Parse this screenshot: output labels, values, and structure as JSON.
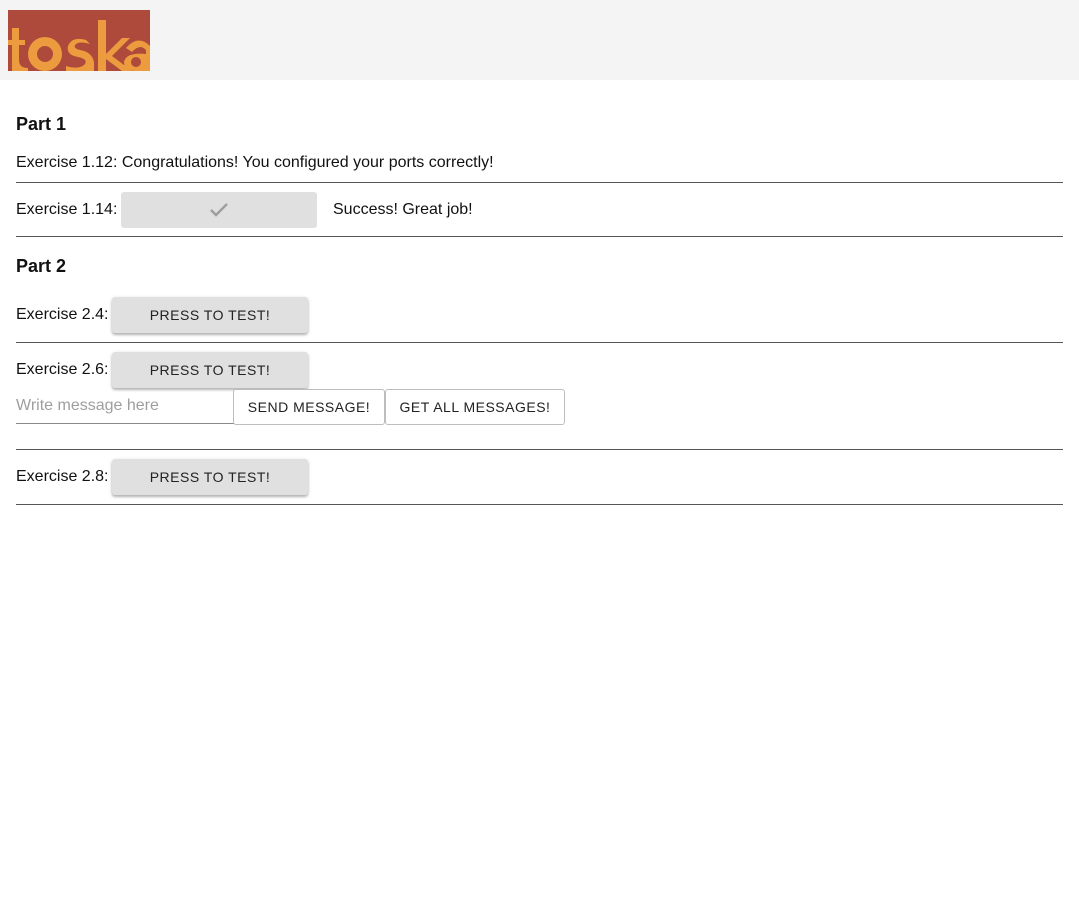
{
  "header": {
    "logo_text": "tosk a",
    "logo_colors": {
      "red": "#ae4a3c",
      "orange": "#ec9b3f"
    }
  },
  "part1": {
    "title": "Part 1",
    "ex112": {
      "label": "Exercise 1.12:",
      "message": "Congratulations! You configured your ports correctly!"
    },
    "ex114": {
      "label": "Exercise 1.14:",
      "button_icon": "check-icon",
      "status": "Success! Great job!"
    }
  },
  "part2": {
    "title": "Part 2",
    "ex24": {
      "label": "Exercise 2.4:",
      "button_label": "PRESS TO TEST!"
    },
    "ex26": {
      "label": "Exercise 2.6:",
      "button_label": "PRESS TO TEST!",
      "input_placeholder": "Write message here",
      "input_value": "",
      "send_label": "SEND MESSAGE!",
      "get_all_label": "GET ALL MESSAGES!"
    },
    "ex28": {
      "label": "Exercise 2.8:",
      "button_label": "PRESS TO TEST!"
    }
  }
}
